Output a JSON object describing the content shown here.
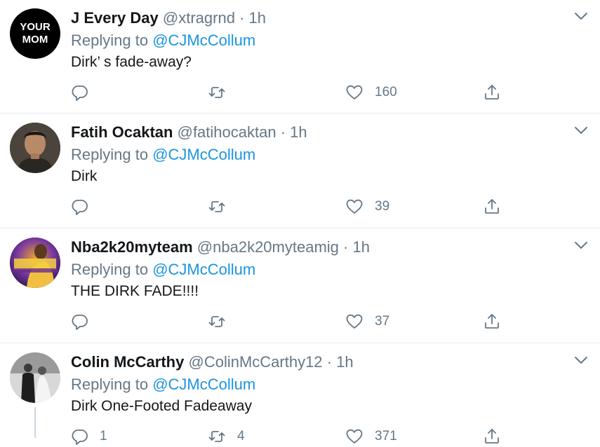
{
  "reply_prefix": "Replying to ",
  "tweets": [
    {
      "name": "J Every Day",
      "handle": "@xtragrnd",
      "sep": "·",
      "time": "1h",
      "reply_to": "@CJMcCollum",
      "text": "Dirk’ s fade-away?",
      "avatar_text": [
        "YOUR",
        "MOM"
      ],
      "replies": "",
      "retweets": "",
      "likes": "160"
    },
    {
      "name": "Fatih Ocaktan",
      "handle": "@fatihocaktan",
      "sep": "·",
      "time": "1h",
      "reply_to": "@CJMcCollum",
      "text": "Dirk",
      "replies": "",
      "retweets": "",
      "likes": "39"
    },
    {
      "name": "Nba2k20myteam",
      "handle": "@nba2k20myteamig",
      "sep": "·",
      "time": "1h",
      "reply_to": "@CJMcCollum",
      "text": "THE DIRK FADE!!!!",
      "replies": "",
      "retweets": "",
      "likes": "37"
    },
    {
      "name": "Colin McCarthy",
      "handle": "@ColinMcCarthy12",
      "sep": "·",
      "time": "1h",
      "reply_to": "@CJMcCollum",
      "text": "Dirk One-Footed Fadeaway",
      "replies": "1",
      "retweets": "4",
      "likes": "371"
    }
  ],
  "colors": {
    "link": "#1b95e0",
    "secondary": "#657786",
    "divider": "#e6ecf0"
  }
}
